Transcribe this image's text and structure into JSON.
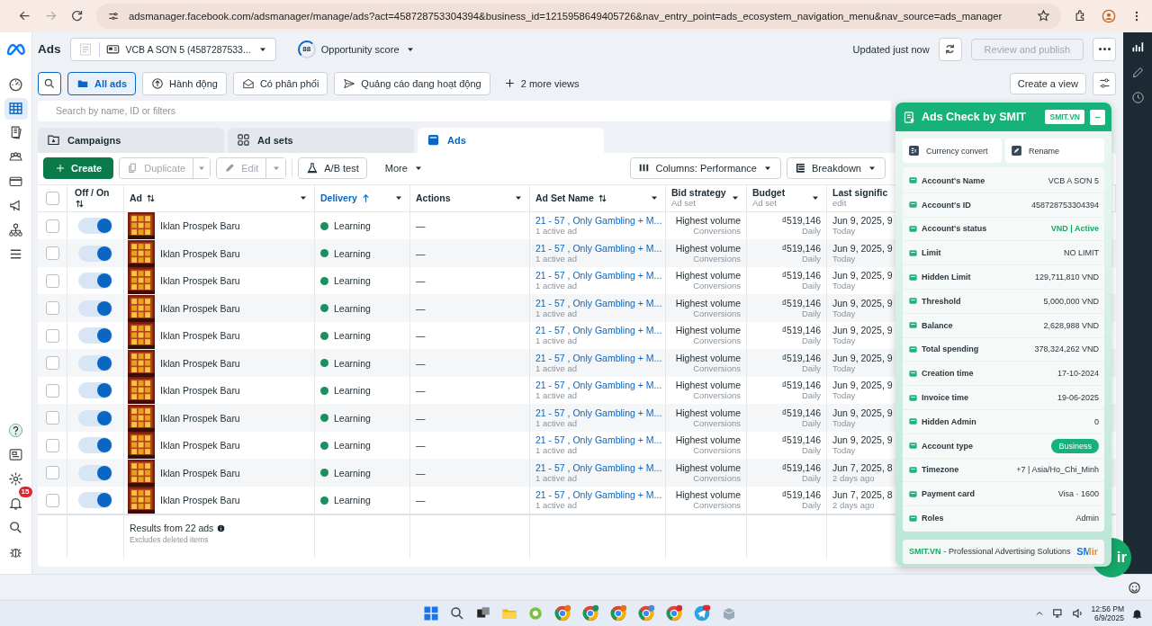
{
  "browser": {
    "url": "adsmanager.facebook.com/adsmanager/manage/ads?act=458728753304394&business_id=1215958649405726&nav_entry_point=ads_ecosystem_navigation_menu&nav_source=ads_manager"
  },
  "rail": {
    "items": [
      {
        "selected": false
      },
      {
        "selected": true
      },
      {
        "selected": false
      },
      {
        "selected": false
      },
      {
        "selected": false
      },
      {
        "selected": false
      },
      {
        "selected": false
      },
      {
        "selected": false
      }
    ],
    "notifications": "15"
  },
  "header": {
    "title": "Ads",
    "account": "VCB A SƠN 5 (4587287533...",
    "score": "88",
    "score_label": "Opportunity score",
    "updated": "Updated just now",
    "publish": {
      "label": "Review and publish",
      "disabled": true
    }
  },
  "views": [
    {
      "label": "All ads",
      "selected": true
    },
    {
      "label": "Hành động",
      "selected": false
    },
    {
      "label": "Có phân phối",
      "selected": false
    },
    {
      "label": "Quảng cáo đang hoạt động",
      "selected": false
    }
  ],
  "more_views": "2 more views",
  "create_view": "Create a view",
  "search": {
    "placeholder": "Search by name, ID or filters"
  },
  "level_tabs": [
    {
      "label": "Campaigns",
      "selected": false
    },
    {
      "label": "Ad sets",
      "selected": false
    },
    {
      "label": "Ads",
      "selected": true
    }
  ],
  "toolbar": {
    "create": "Create",
    "duplicate": {
      "label": "Duplicate",
      "disabled": true
    },
    "edit": {
      "label": "Edit",
      "disabled": true
    },
    "ab_test": "A/B test",
    "more": "More",
    "columns": "Columns: Performance",
    "breakdown": "Breakdown"
  },
  "table": {
    "all_selected": false,
    "columns": [
      {
        "label": "Off / On",
        "sortable": true,
        "sorted": false
      },
      {
        "label": "Ad",
        "sortable": true,
        "sorted": false
      },
      {
        "label": "Delivery",
        "sortable": true,
        "sorted": true
      },
      {
        "label": "Actions",
        "sortable": false,
        "sorted": false
      },
      {
        "label": "Ad Set Name",
        "sortable": true,
        "sorted": false
      },
      {
        "label": "Bid strategy",
        "sub": "Ad set",
        "sortable": false,
        "sorted": false
      },
      {
        "label": "Budget",
        "sub": "Ad set",
        "sortable": false,
        "sorted": false
      },
      {
        "label": "Last signific",
        "sub": "edit",
        "sortable": false,
        "sorted": false
      }
    ],
    "rows": [
      {
        "selected": false,
        "on": true,
        "name": "Iklan Prospek Baru",
        "delivery": "Learning",
        "actions": "—",
        "ad_set": "21 - 57 , Only Gambling + M...",
        "ad_set_sub": "1 active ad",
        "bid": "Highest volume",
        "bid_sub": "Conversions",
        "budget": "₫519,146",
        "budget_sub": "Daily",
        "edited": "Jun 9, 2025, 9",
        "edited_sub": "Today"
      },
      {
        "selected": false,
        "on": true,
        "name": "Iklan Prospek Baru",
        "delivery": "Learning",
        "actions": "—",
        "ad_set": "21 - 57 , Only Gambling + M...",
        "ad_set_sub": "1 active ad",
        "bid": "Highest volume",
        "bid_sub": "Conversions",
        "budget": "₫519,146",
        "budget_sub": "Daily",
        "edited": "Jun 9, 2025, 9",
        "edited_sub": "Today"
      },
      {
        "selected": false,
        "on": true,
        "name": "Iklan Prospek Baru",
        "delivery": "Learning",
        "actions": "—",
        "ad_set": "21 - 57 , Only Gambling + M...",
        "ad_set_sub": "1 active ad",
        "bid": "Highest volume",
        "bid_sub": "Conversions",
        "budget": "₫519,146",
        "budget_sub": "Daily",
        "edited": "Jun 9, 2025, 9",
        "edited_sub": "Today"
      },
      {
        "selected": false,
        "on": true,
        "name": "Iklan Prospek Baru",
        "delivery": "Learning",
        "actions": "—",
        "ad_set": "21 - 57 , Only Gambling + M...",
        "ad_set_sub": "1 active ad",
        "bid": "Highest volume",
        "bid_sub": "Conversions",
        "budget": "₫519,146",
        "budget_sub": "Daily",
        "edited": "Jun 9, 2025, 9",
        "edited_sub": "Today"
      },
      {
        "selected": false,
        "on": true,
        "name": "Iklan Prospek Baru",
        "delivery": "Learning",
        "actions": "—",
        "ad_set": "21 - 57 , Only Gambling + M...",
        "ad_set_sub": "1 active ad",
        "bid": "Highest volume",
        "bid_sub": "Conversions",
        "budget": "₫519,146",
        "budget_sub": "Daily",
        "edited": "Jun 9, 2025, 9",
        "edited_sub": "Today"
      },
      {
        "selected": false,
        "on": true,
        "name": "Iklan Prospek Baru",
        "delivery": "Learning",
        "actions": "—",
        "ad_set": "21 - 57 , Only Gambling + M...",
        "ad_set_sub": "1 active ad",
        "bid": "Highest volume",
        "bid_sub": "Conversions",
        "budget": "₫519,146",
        "budget_sub": "Daily",
        "edited": "Jun 9, 2025, 9",
        "edited_sub": "Today"
      },
      {
        "selected": false,
        "on": true,
        "name": "Iklan Prospek Baru",
        "delivery": "Learning",
        "actions": "—",
        "ad_set": "21 - 57 , Only Gambling + M...",
        "ad_set_sub": "1 active ad",
        "bid": "Highest volume",
        "bid_sub": "Conversions",
        "budget": "₫519,146",
        "budget_sub": "Daily",
        "edited": "Jun 9, 2025, 9",
        "edited_sub": "Today"
      },
      {
        "selected": false,
        "on": true,
        "name": "Iklan Prospek Baru",
        "delivery": "Learning",
        "actions": "—",
        "ad_set": "21 - 57 , Only Gambling + M...",
        "ad_set_sub": "1 active ad",
        "bid": "Highest volume",
        "bid_sub": "Conversions",
        "budget": "₫519,146",
        "budget_sub": "Daily",
        "edited": "Jun 9, 2025, 9",
        "edited_sub": "Today"
      },
      {
        "selected": false,
        "on": true,
        "name": "Iklan Prospek Baru",
        "delivery": "Learning",
        "actions": "—",
        "ad_set": "21 - 57 , Only Gambling + M...",
        "ad_set_sub": "1 active ad",
        "bid": "Highest volume",
        "bid_sub": "Conversions",
        "budget": "₫519,146",
        "budget_sub": "Daily",
        "edited": "Jun 9, 2025, 9",
        "edited_sub": "Today"
      },
      {
        "selected": false,
        "on": true,
        "name": "Iklan Prospek Baru",
        "delivery": "Learning",
        "actions": "—",
        "ad_set": "21 - 57 , Only Gambling + M...",
        "ad_set_sub": "1 active ad",
        "bid": "Highest volume",
        "bid_sub": "Conversions",
        "budget": "₫519,146",
        "budget_sub": "Daily",
        "edited": "Jun 7, 2025, 8",
        "edited_sub": "2 days ago"
      },
      {
        "selected": false,
        "on": true,
        "name": "Iklan Prospek Baru",
        "delivery": "Learning",
        "actions": "—",
        "ad_set": "21 - 57 , Only Gambling + M...",
        "ad_set_sub": "1 active ad",
        "bid": "Highest volume",
        "bid_sub": "Conversions",
        "budget": "₫519,146",
        "budget_sub": "Daily",
        "edited": "Jun 7, 2025, 8",
        "edited_sub": "2 days ago"
      }
    ],
    "footer": {
      "results": "Results from 22 ads",
      "note": "Excludes deleted items"
    }
  },
  "panel": {
    "title": "Ads Check by SMIT",
    "badge": "SMIT.VN",
    "minimize": "–",
    "buttons": [
      "Currency convert",
      "Rename"
    ],
    "rows": [
      {
        "label": "Account's Name",
        "value": "VCB A SƠN 5",
        "kind": "text"
      },
      {
        "label": "Account's ID",
        "value": "458728753304394",
        "kind": "text"
      },
      {
        "label": "Account's status",
        "value": "VND | Active",
        "kind": "status"
      },
      {
        "label": "Limit",
        "value": "NO LIMIT",
        "kind": "text"
      },
      {
        "label": "Hidden Limit",
        "value": "129,711,810 VND",
        "kind": "text"
      },
      {
        "label": "Threshold",
        "value": "5,000,000 VND",
        "kind": "text"
      },
      {
        "label": "Balance",
        "value": "2,628,988 VND",
        "kind": "text"
      },
      {
        "label": "Total spending",
        "value": "378,324,262 VND",
        "kind": "text"
      },
      {
        "label": "Creation time",
        "value": "17-10-2024",
        "kind": "text"
      },
      {
        "label": "Invoice time",
        "value": "19-06-2025",
        "kind": "text"
      },
      {
        "label": "Hidden Admin",
        "value": "0",
        "kind": "text"
      },
      {
        "label": "Account type",
        "value": "Business",
        "kind": "badge"
      },
      {
        "label": "Timezone",
        "value": "+7 | Asia/Ho_Chi_Minh",
        "kind": "text"
      },
      {
        "label": "Payment card",
        "value": "Visa · 1600",
        "kind": "text"
      },
      {
        "label": "Roles",
        "value": "Admin",
        "kind": "text"
      }
    ],
    "footer": {
      "brand": "SMIT.VN",
      "text": "- Professional Advertising Solutions",
      "logo": "SMir"
    },
    "fab": "ir"
  },
  "taskbar": {
    "time": "12:56 PM",
    "date": "6/9/2025"
  }
}
